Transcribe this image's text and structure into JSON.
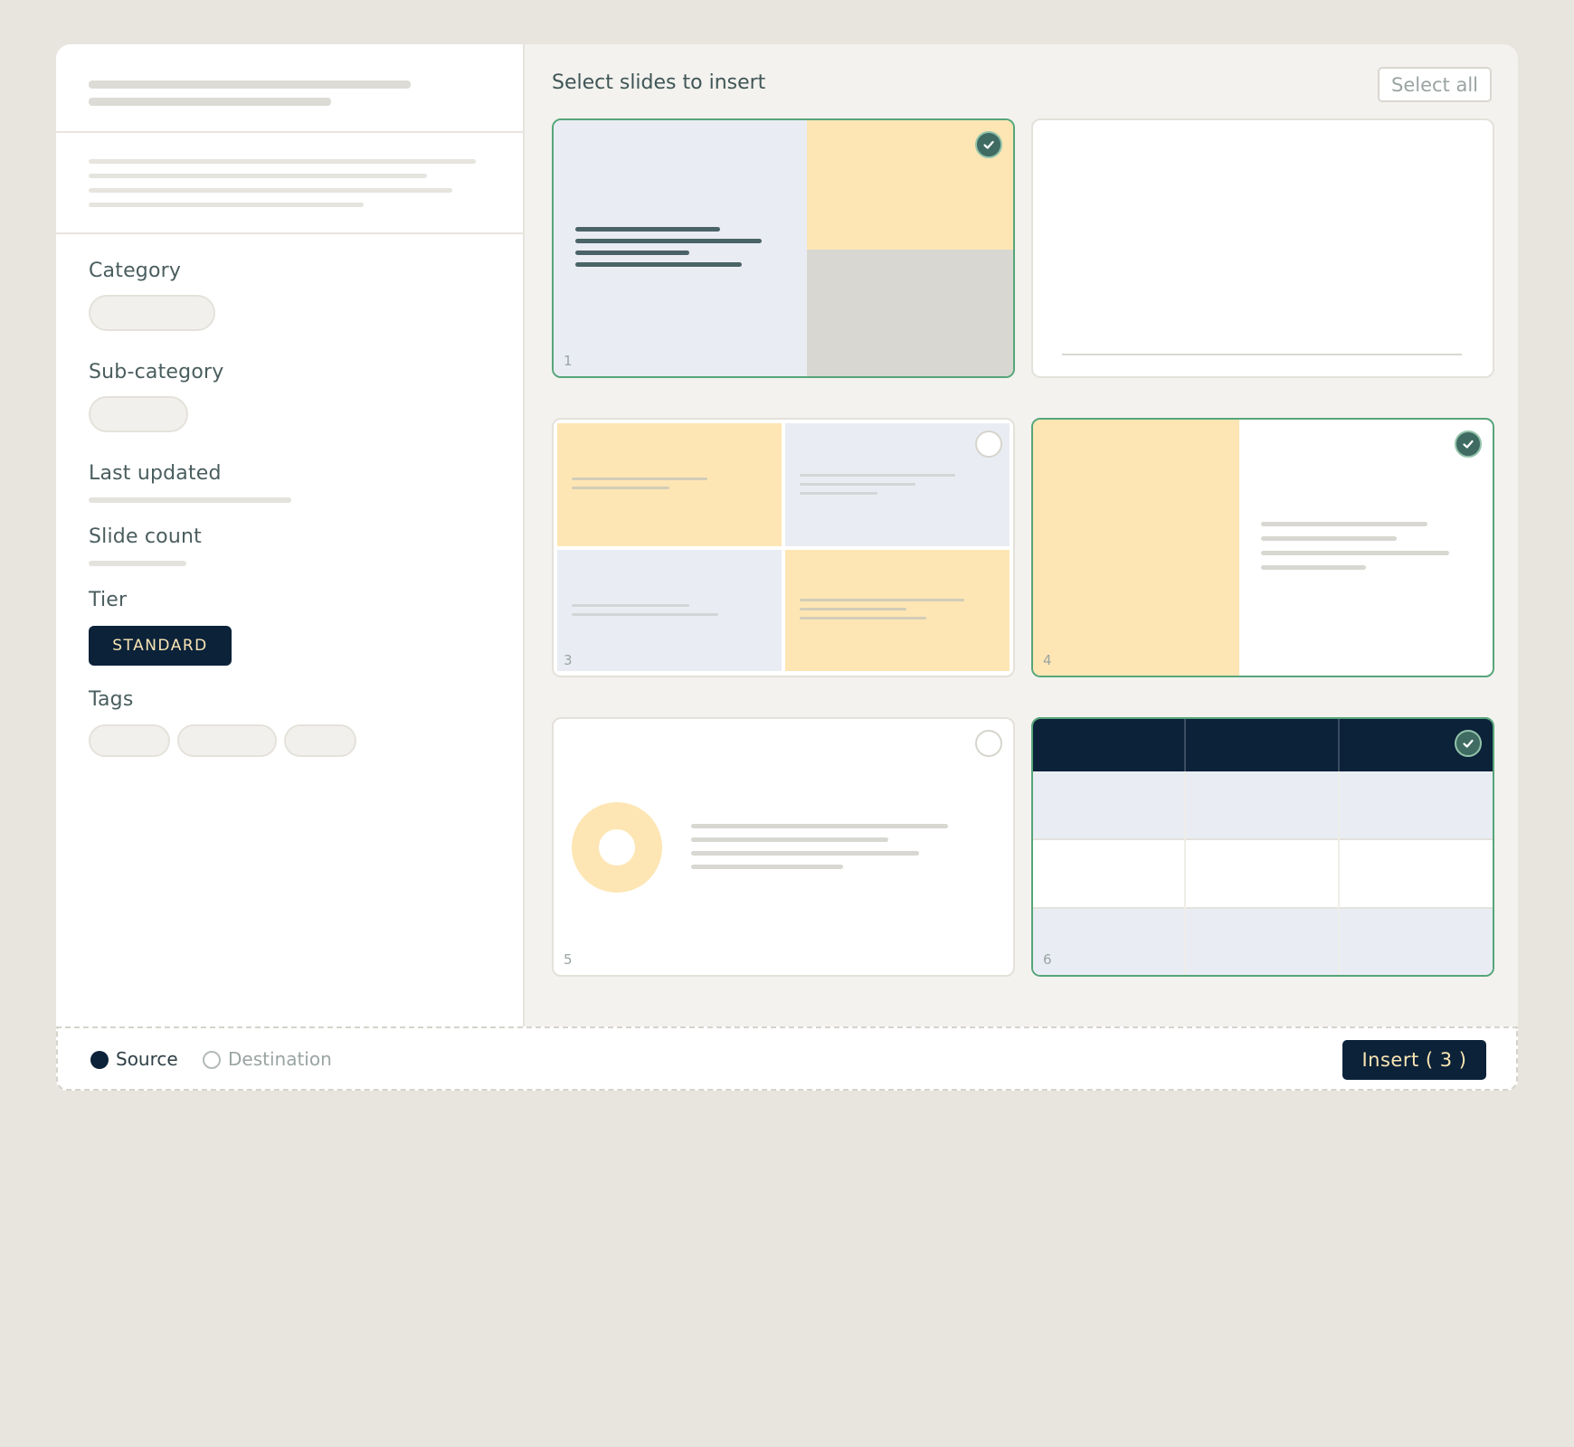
{
  "details": {
    "category_label": "Category",
    "subcategory_label": "Sub-category",
    "last_updated_label": "Last updated",
    "slide_count_label": "Slide count",
    "tier_label": "Tier",
    "tier_value": "STANDARD",
    "tags_label": "Tags"
  },
  "panel": {
    "title": "Select slides to insert",
    "select_all_label": "Select all"
  },
  "slides": [
    {
      "number": "1",
      "selected": true
    },
    {
      "number": "",
      "selected": false
    },
    {
      "number": "3",
      "selected": false
    },
    {
      "number": "4",
      "selected": true
    },
    {
      "number": "5",
      "selected": false
    },
    {
      "number": "6",
      "selected": true
    }
  ],
  "footer": {
    "source_label": "Source",
    "destination_label": "Destination",
    "active_option": "Source",
    "insert_label": "Insert ( 3 )"
  },
  "colors": {
    "navy": "#0b2239",
    "accent_yellow": "#fde6b4",
    "selected_border": "#56a57a",
    "slide_blue": "#e9edf3"
  },
  "icons": {
    "selected_check": "check-icon",
    "radio": "radio-icon"
  }
}
